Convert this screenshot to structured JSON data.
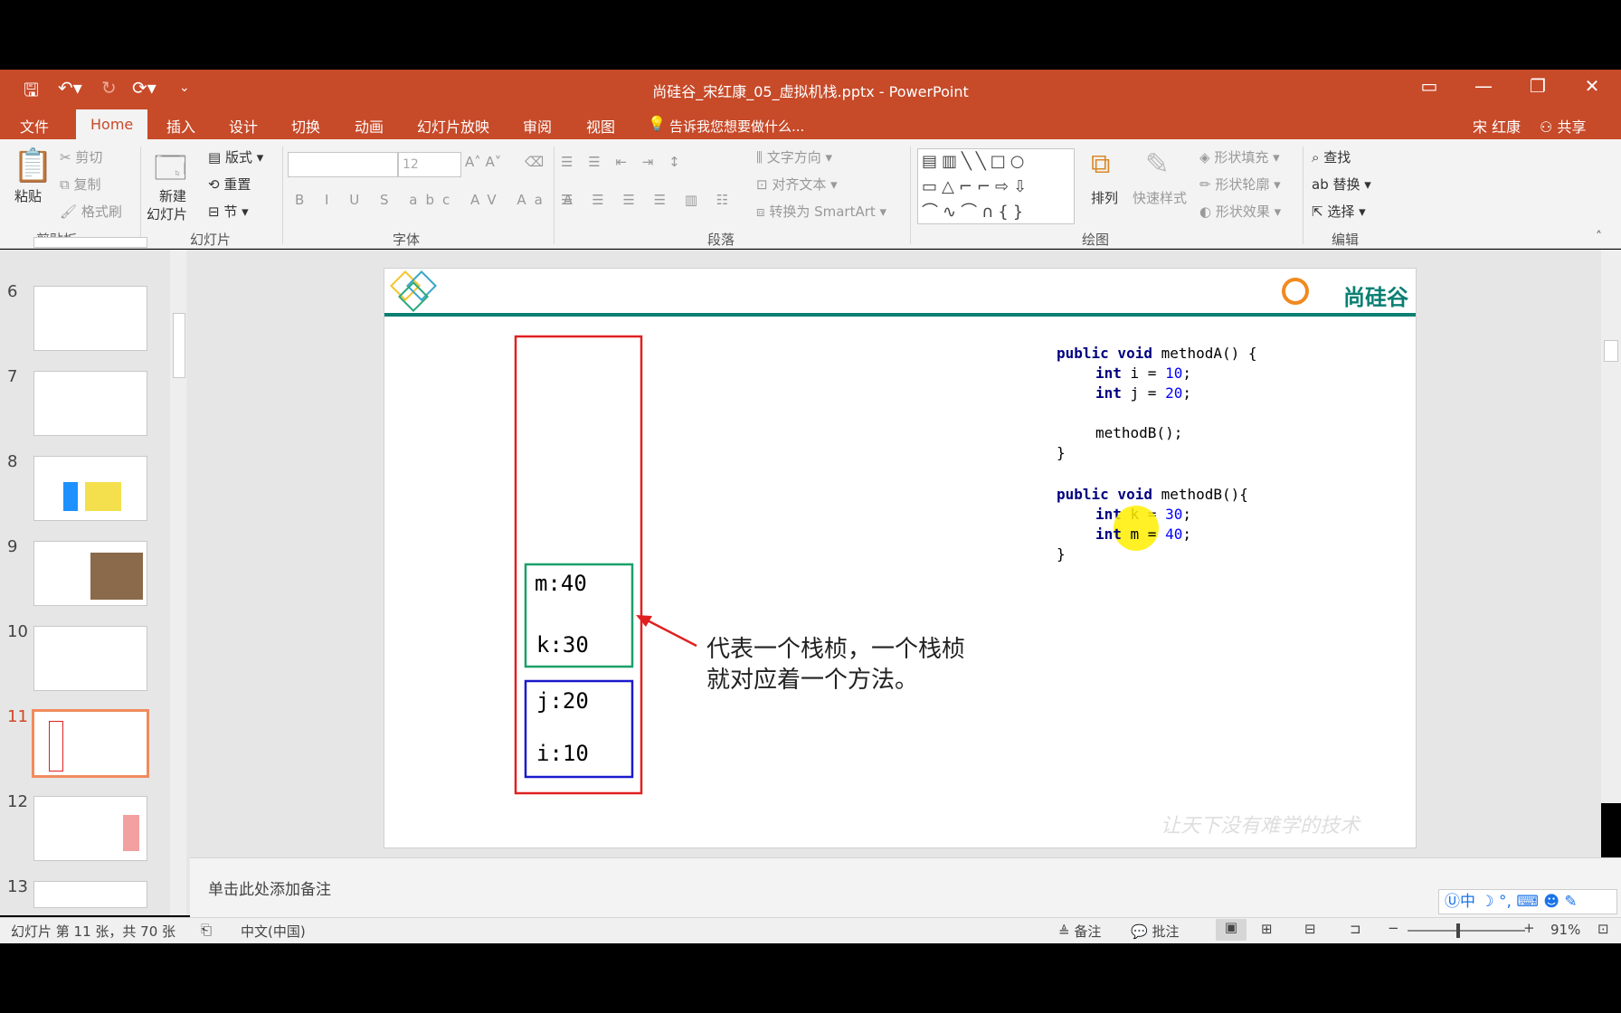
{
  "window": {
    "title": "尚硅谷_宋红康_05_虚拟机栈.pptx - PowerPoint",
    "user": "宋 红康",
    "share": "共享"
  },
  "tabs": [
    "文件",
    "Home",
    "插入",
    "设计",
    "切换",
    "动画",
    "幻灯片放映",
    "审阅",
    "视图"
  ],
  "tell_me": "告诉我您想要做什么...",
  "ribbon": {
    "clipboard": {
      "paste": "粘贴",
      "cut": "剪切",
      "copy": "复制",
      "format_painter": "格式刷",
      "group": "剪贴板"
    },
    "slides": {
      "new_slide_1": "新建",
      "new_slide_2": "幻灯片",
      "layout": "版式",
      "reset": "重置",
      "section": "节",
      "group": "幻灯片"
    },
    "font": {
      "size": "12",
      "group": "字体"
    },
    "paragraph": {
      "text_direction": "文字方向",
      "align_text": "对齐文本",
      "smartart": "转换为 SmartArt",
      "group": "段落"
    },
    "drawing": {
      "arrange": "排列",
      "quick_styles": "快速样式",
      "fill": "形状填充",
      "outline": "形状轮廓",
      "effects": "形状效果",
      "group": "绘图"
    },
    "editing": {
      "find": "查找",
      "replace": "替换",
      "select": "选择",
      "group": "编辑"
    }
  },
  "thumbnails": [
    {
      "num": "6"
    },
    {
      "num": "7"
    },
    {
      "num": "8"
    },
    {
      "num": "9"
    },
    {
      "num": "10"
    },
    {
      "num": "11"
    },
    {
      "num": "12"
    },
    {
      "num": "13"
    }
  ],
  "slide": {
    "logo": "尚硅谷",
    "watermark": "让天下没有难学的技术",
    "frames": {
      "m": "m:40",
      "k": "k:30",
      "j": "j:20",
      "i": "i:10"
    },
    "annotation": [
      "代表一个栈桢，一个栈桢",
      "就对应着一个方法。"
    ],
    "code": {
      "a1_kw": "public void",
      "a1_rest": " methodA() {",
      "a2_kw": "int",
      "a2_rest": " i = ",
      "a2_num": "10",
      "a2_end": ";",
      "a3_kw": "int",
      "a3_rest": " j = ",
      "a3_num": "20",
      "a3_end": ";",
      "a4": "methodB();",
      "a5": "}",
      "b1_kw": "public void",
      "b1_rest": " methodB(){",
      "b2_kw": "int",
      "b2_rest": " k = ",
      "b2_num": "30",
      "b2_end": ";",
      "b3_kw": "int",
      "b3_rest": " m = ",
      "b3_num": "40",
      "b3_end": ";",
      "b4": "}"
    }
  },
  "notes_placeholder": "单击此处添加备注",
  "status": {
    "slide_info": "幻灯片 第 11 张，共 70 张",
    "language": "中文(中国)",
    "notes": "备注",
    "comments": "批注",
    "zoom": "91%"
  },
  "colors": {
    "accent": "#c74a29",
    "stack_red": "#e02020",
    "frame_green": "#1aa06a",
    "frame_blue": "#1a1acc",
    "slide_teal": "#0a7f73"
  }
}
